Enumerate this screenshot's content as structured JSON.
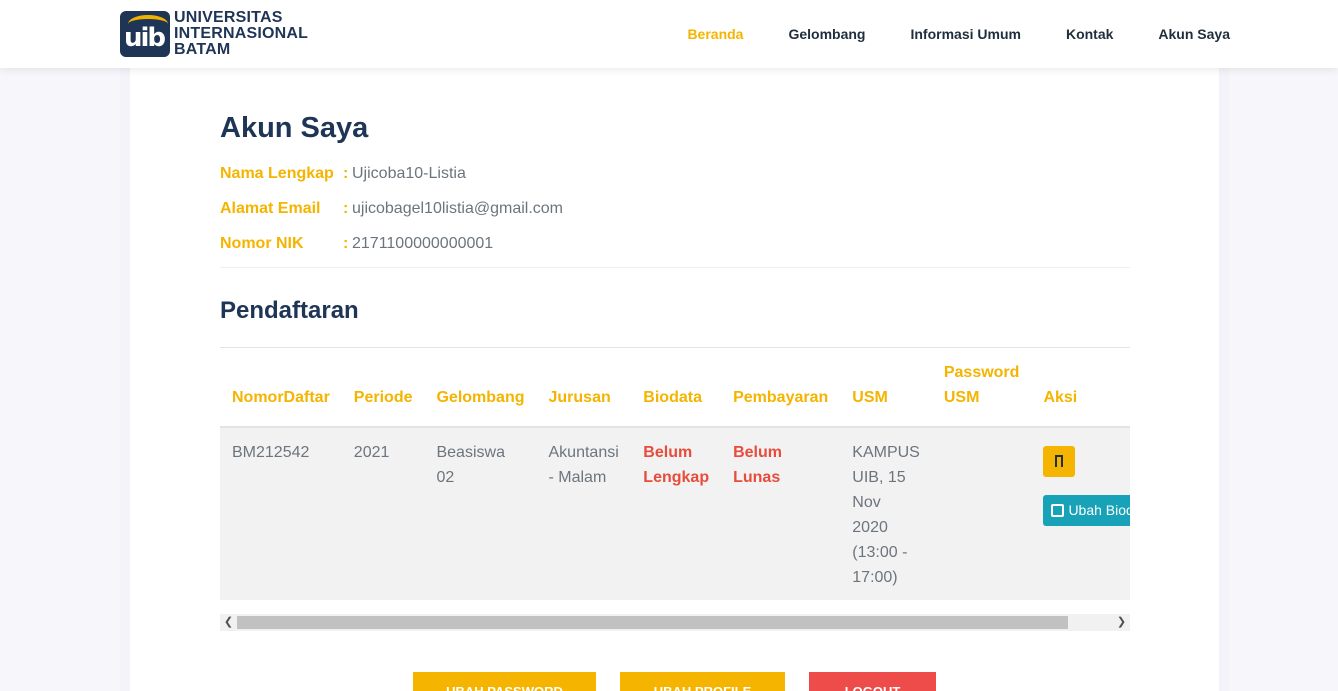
{
  "header": {
    "logo_mark": "uib",
    "logo_lines": [
      "UNIVERSITAS",
      "INTERNASIONAL",
      "BATAM"
    ],
    "nav": [
      {
        "label": "Beranda",
        "active": true
      },
      {
        "label": "Gelombang",
        "active": false
      },
      {
        "label": "Informasi Umum",
        "active": false
      },
      {
        "label": "Kontak",
        "active": false
      },
      {
        "label": "Akun Saya",
        "active": false
      }
    ]
  },
  "account": {
    "title": "Akun Saya",
    "fields": [
      {
        "label": "Nama Lengkap",
        "value": "Ujicoba10-Listia"
      },
      {
        "label": "Alamat Email",
        "value": "ujicobagel10listia@gmail.com"
      },
      {
        "label": "Nomor NIK",
        "value": "2171100000000001"
      }
    ]
  },
  "registration": {
    "title": "Pendaftaran",
    "columns": [
      "NomorDaftar",
      "Periode",
      "Gelombang",
      "Jurusan",
      "Biodata",
      "Pembayaran",
      "USM",
      "Password USM",
      "Aksi"
    ],
    "rows": [
      {
        "nomor_daftar": "BM212542",
        "periode": "2021",
        "gelombang": "Beasiswa 02",
        "jurusan": "Akuntansi - Malam",
        "biodata": "Belum Lengkap",
        "pembayaran": "Belum Lunas",
        "usm": "KAMPUS UIB, 15 Nov 2020 (13:00 - 17:00)",
        "password_usm": "",
        "edit_label": "Ubah Biodata"
      }
    ]
  },
  "buttons": {
    "password": "UBAH PASSWORD",
    "profile": "UBAH PROFILE",
    "logout": "LOGOUT"
  },
  "colors": {
    "accent": "#f4b400",
    "navy": "#1f3556",
    "danger": "#e74c3c",
    "info": "#17a2b8"
  }
}
